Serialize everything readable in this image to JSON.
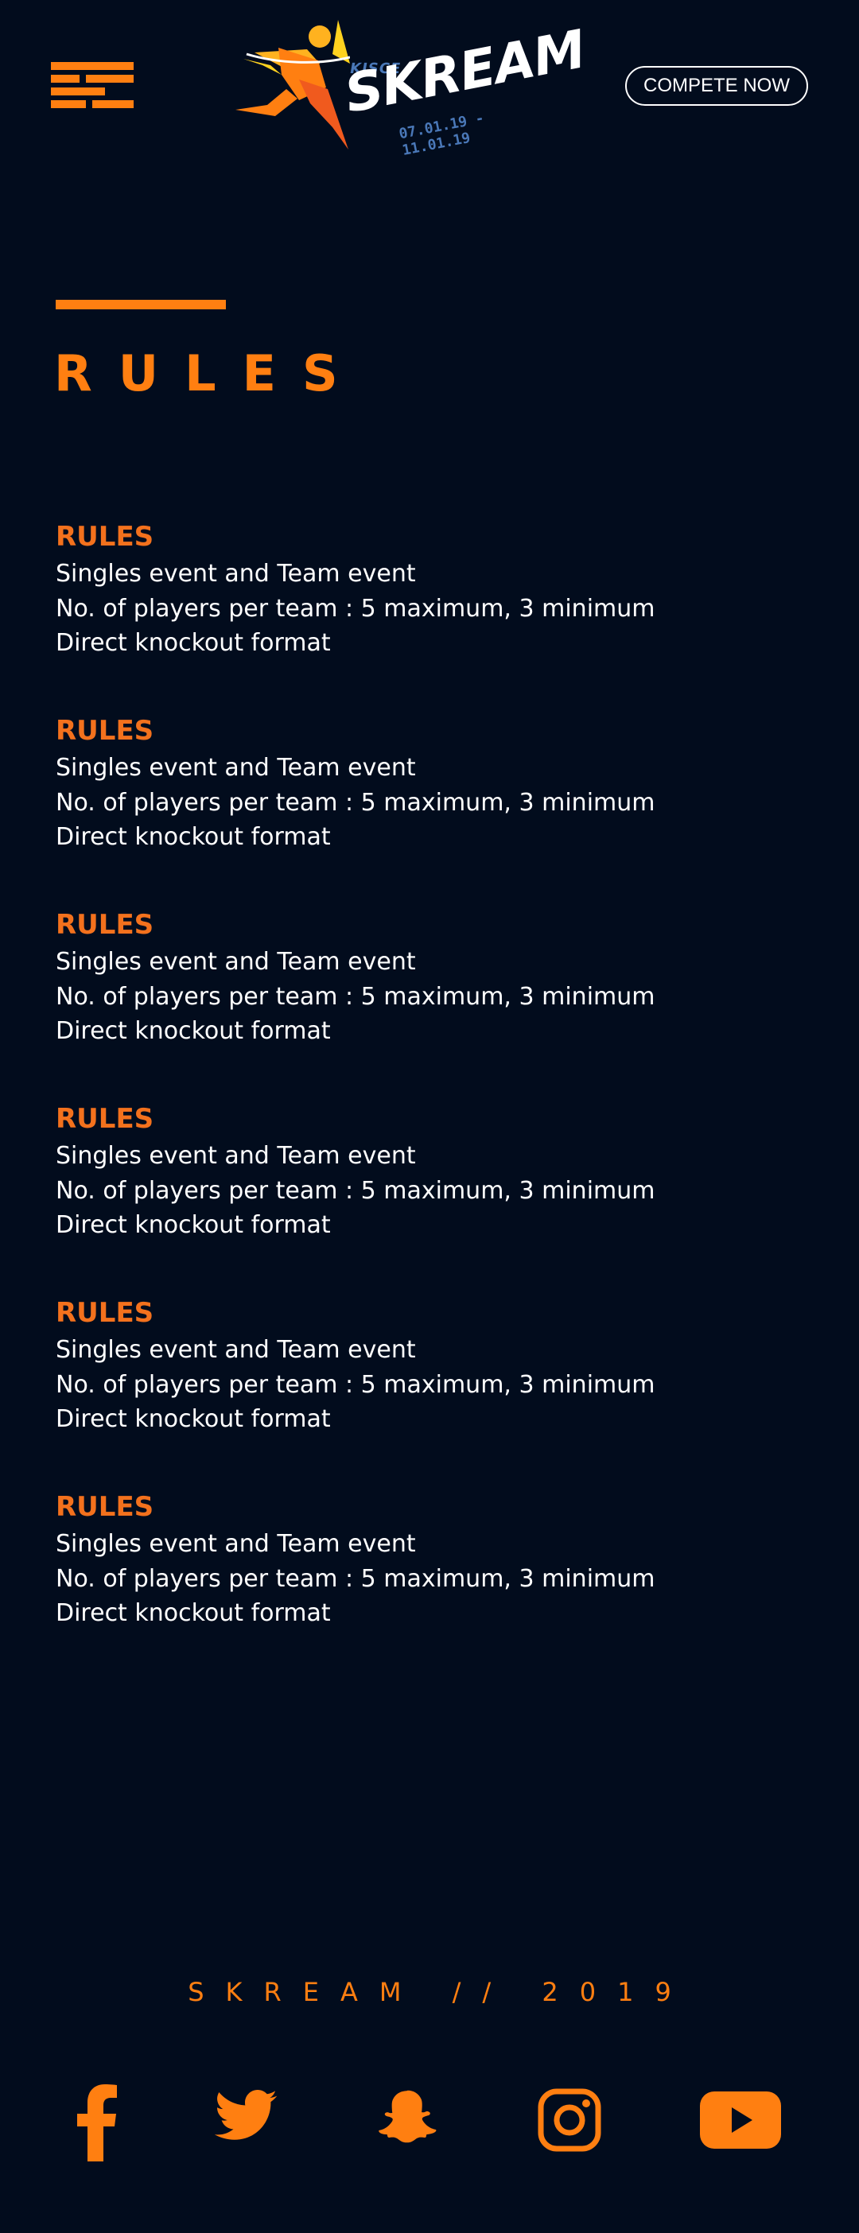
{
  "header": {
    "logo": {
      "org": "KJSCE",
      "name": "SKREAM",
      "dates": "07.01.19 - 11.01.19"
    },
    "cta_label": "COMPETE NOW",
    "menu_icon": "hamburger-menu-icon"
  },
  "page": {
    "title": "RULES"
  },
  "rules": [
    {
      "heading": "RULES",
      "lines": [
        "Singles event and Team event",
        "No. of players per team : 5 maximum, 3 minimum",
        "Direct knockout format"
      ]
    },
    {
      "heading": "RULES",
      "lines": [
        "Singles event and Team event",
        "No. of players per team : 5 maximum, 3 minimum",
        "Direct knockout format"
      ]
    },
    {
      "heading": "RULES",
      "lines": [
        "Singles event and Team event",
        "No. of players per team : 5 maximum, 3 minimum",
        "Direct knockout format"
      ]
    },
    {
      "heading": "RULES",
      "lines": [
        "Singles event and Team event",
        "No. of players per team : 5 maximum, 3 minimum",
        "Direct knockout format"
      ]
    },
    {
      "heading": "RULES",
      "lines": [
        "Singles event and Team event",
        "No. of players per team : 5 maximum, 3 minimum",
        "Direct knockout format"
      ]
    },
    {
      "heading": "RULES",
      "lines": [
        "Singles event and Team event",
        "No. of players per team : 5 maximum, 3 minimum",
        "Direct knockout format"
      ]
    }
  ],
  "footer": {
    "brand": "SKREAM // 2019",
    "social": [
      "facebook-icon",
      "twitter-icon",
      "snapchat-icon",
      "instagram-icon",
      "youtube-icon"
    ]
  },
  "colors": {
    "background": "#020c1d",
    "accent": "#ff7f11",
    "heading": "#f3711d",
    "text": "#ffffff",
    "logo_blue": "#4a78b8"
  }
}
